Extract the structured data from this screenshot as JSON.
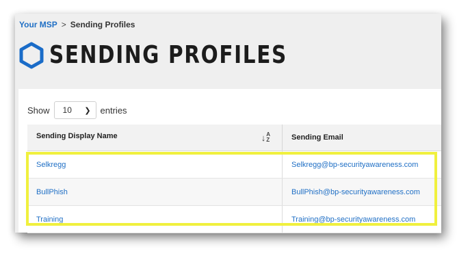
{
  "breadcrumb": {
    "root": "Your MSP",
    "separator": ">",
    "current": "Sending Profiles"
  },
  "page": {
    "title": "SENDING PROFILES",
    "title_icon": "hexagon-outline-icon"
  },
  "length_menu": {
    "prefix": "Show",
    "value": "10",
    "suffix": "entries"
  },
  "table": {
    "columns": [
      "Sending Display Name",
      "Sending Email"
    ],
    "sort_icon": "sort-alpha-down-icon",
    "rows": [
      {
        "name": "Selkregg",
        "email": "Selkregg@bp-securityawareness.com"
      },
      {
        "name": "BullPhish",
        "email": "BullPhish@bp-securityawareness.com"
      },
      {
        "name": "Training",
        "email": "Training@bp-securityawareness.com"
      }
    ]
  },
  "colors": {
    "link": "#1f6fc5",
    "hexagon": "#1a6cc8",
    "highlight": "#f0f03e"
  }
}
